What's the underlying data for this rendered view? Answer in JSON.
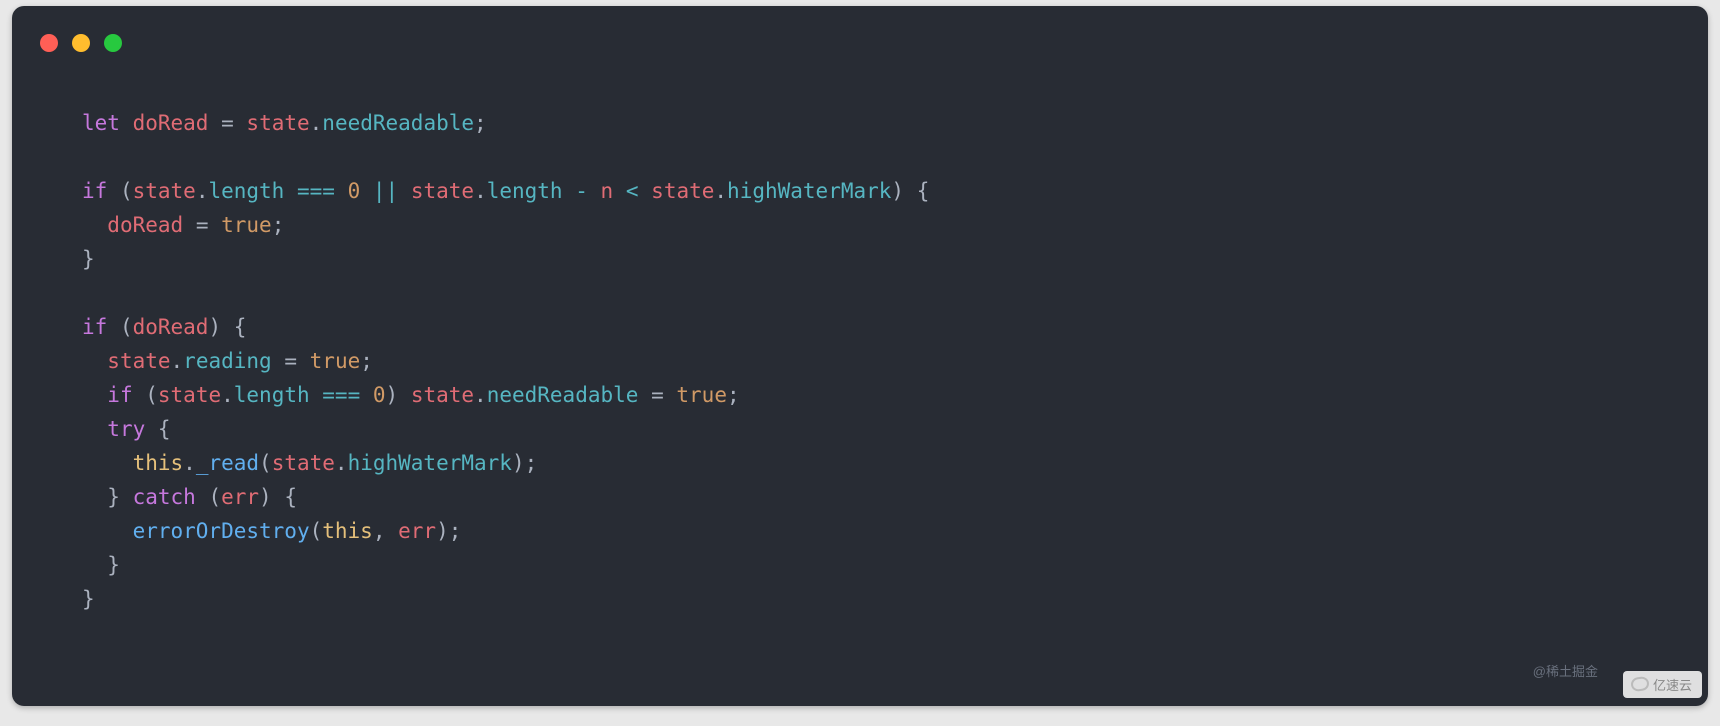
{
  "window": {
    "dot_red": "#ff5f56",
    "dot_yellow": "#ffbd2e",
    "dot_green": "#27c93f"
  },
  "code": {
    "tokens": [
      [
        [
          "kw",
          "let"
        ],
        [
          "punc",
          " "
        ],
        [
          "id",
          "doRead"
        ],
        [
          "punc",
          " "
        ],
        [
          "eq",
          "="
        ],
        [
          "punc",
          " "
        ],
        [
          "id",
          "state"
        ],
        [
          "punc",
          "."
        ],
        [
          "prop",
          "needReadable"
        ],
        [
          "punc",
          ";"
        ]
      ],
      [],
      [
        [
          "kw",
          "if"
        ],
        [
          "punc",
          " ("
        ],
        [
          "id",
          "state"
        ],
        [
          "punc",
          "."
        ],
        [
          "prop",
          "length"
        ],
        [
          "punc",
          " "
        ],
        [
          "op",
          "==="
        ],
        [
          "punc",
          " "
        ],
        [
          "num",
          "0"
        ],
        [
          "punc",
          " "
        ],
        [
          "op",
          "||"
        ],
        [
          "punc",
          " "
        ],
        [
          "id",
          "state"
        ],
        [
          "punc",
          "."
        ],
        [
          "prop",
          "length"
        ],
        [
          "punc",
          " "
        ],
        [
          "op",
          "-"
        ],
        [
          "punc",
          " "
        ],
        [
          "id",
          "n"
        ],
        [
          "punc",
          " "
        ],
        [
          "op",
          "<"
        ],
        [
          "punc",
          " "
        ],
        [
          "id",
          "state"
        ],
        [
          "punc",
          "."
        ],
        [
          "prop",
          "highWaterMark"
        ],
        [
          "punc",
          ") {"
        ]
      ],
      [
        [
          "punc",
          "  "
        ],
        [
          "id",
          "doRead"
        ],
        [
          "punc",
          " "
        ],
        [
          "eq",
          "="
        ],
        [
          "punc",
          " "
        ],
        [
          "bool",
          "true"
        ],
        [
          "punc",
          ";"
        ]
      ],
      [
        [
          "punc",
          "}"
        ]
      ],
      [],
      [
        [
          "kw",
          "if"
        ],
        [
          "punc",
          " ("
        ],
        [
          "id",
          "doRead"
        ],
        [
          "punc",
          ") {"
        ]
      ],
      [
        [
          "punc",
          "  "
        ],
        [
          "id",
          "state"
        ],
        [
          "punc",
          "."
        ],
        [
          "prop",
          "reading"
        ],
        [
          "punc",
          " "
        ],
        [
          "eq",
          "="
        ],
        [
          "punc",
          " "
        ],
        [
          "bool",
          "true"
        ],
        [
          "punc",
          ";"
        ]
      ],
      [
        [
          "punc",
          "  "
        ],
        [
          "kw",
          "if"
        ],
        [
          "punc",
          " ("
        ],
        [
          "id",
          "state"
        ],
        [
          "punc",
          "."
        ],
        [
          "prop",
          "length"
        ],
        [
          "punc",
          " "
        ],
        [
          "op",
          "==="
        ],
        [
          "punc",
          " "
        ],
        [
          "num",
          "0"
        ],
        [
          "punc",
          ") "
        ],
        [
          "id",
          "state"
        ],
        [
          "punc",
          "."
        ],
        [
          "prop",
          "needReadable"
        ],
        [
          "punc",
          " "
        ],
        [
          "eq",
          "="
        ],
        [
          "punc",
          " "
        ],
        [
          "bool",
          "true"
        ],
        [
          "punc",
          ";"
        ]
      ],
      [
        [
          "punc",
          "  "
        ],
        [
          "kw",
          "try"
        ],
        [
          "punc",
          " {"
        ]
      ],
      [
        [
          "punc",
          "    "
        ],
        [
          "this",
          "this"
        ],
        [
          "punc",
          "."
        ],
        [
          "fn",
          "_read"
        ],
        [
          "punc",
          "("
        ],
        [
          "id",
          "state"
        ],
        [
          "punc",
          "."
        ],
        [
          "prop",
          "highWaterMark"
        ],
        [
          "punc",
          ");"
        ]
      ],
      [
        [
          "punc",
          "  } "
        ],
        [
          "kw",
          "catch"
        ],
        [
          "punc",
          " ("
        ],
        [
          "id",
          "err"
        ],
        [
          "punc",
          ") {"
        ]
      ],
      [
        [
          "punc",
          "    "
        ],
        [
          "fn",
          "errorOrDestroy"
        ],
        [
          "punc",
          "("
        ],
        [
          "this",
          "this"
        ],
        [
          "punc",
          ", "
        ],
        [
          "id",
          "err"
        ],
        [
          "punc",
          ");"
        ]
      ],
      [
        [
          "punc",
          "  }"
        ]
      ],
      [
        [
          "punc",
          "}"
        ]
      ]
    ]
  },
  "watermark1": "@稀土掘金",
  "watermark2": "亿速云"
}
